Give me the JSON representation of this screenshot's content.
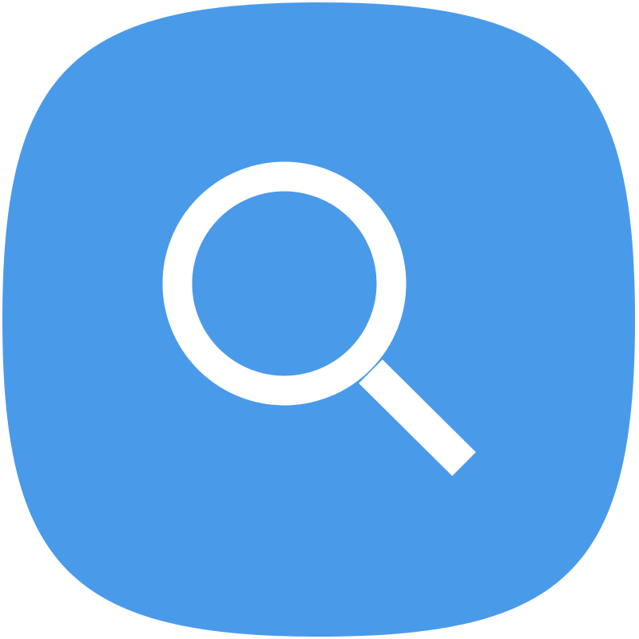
{
  "app_icon": {
    "name": "search",
    "glyph": "magnifying-glass",
    "colors": {
      "tile": "#4A9AEA",
      "glyph": "#FFFFFF"
    }
  }
}
